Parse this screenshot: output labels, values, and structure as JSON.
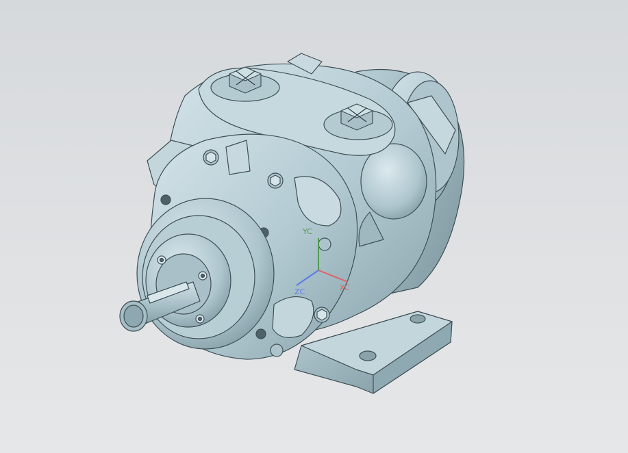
{
  "viewport": {
    "background_top": "#d6d9dc",
    "background_bottom": "#e6e7e9",
    "model": {
      "body_color": "#b9cfd6",
      "highlight_color": "#dbe9ee",
      "shadow_color": "#7f9aa3",
      "edge_color": "#3e4f55"
    }
  },
  "triad": {
    "y_label": "YC",
    "x_label": "XC",
    "z_label": "ZC",
    "x_color": "#e06060",
    "y_color": "#4f9a4f",
    "z_color": "#5a7ae6"
  }
}
